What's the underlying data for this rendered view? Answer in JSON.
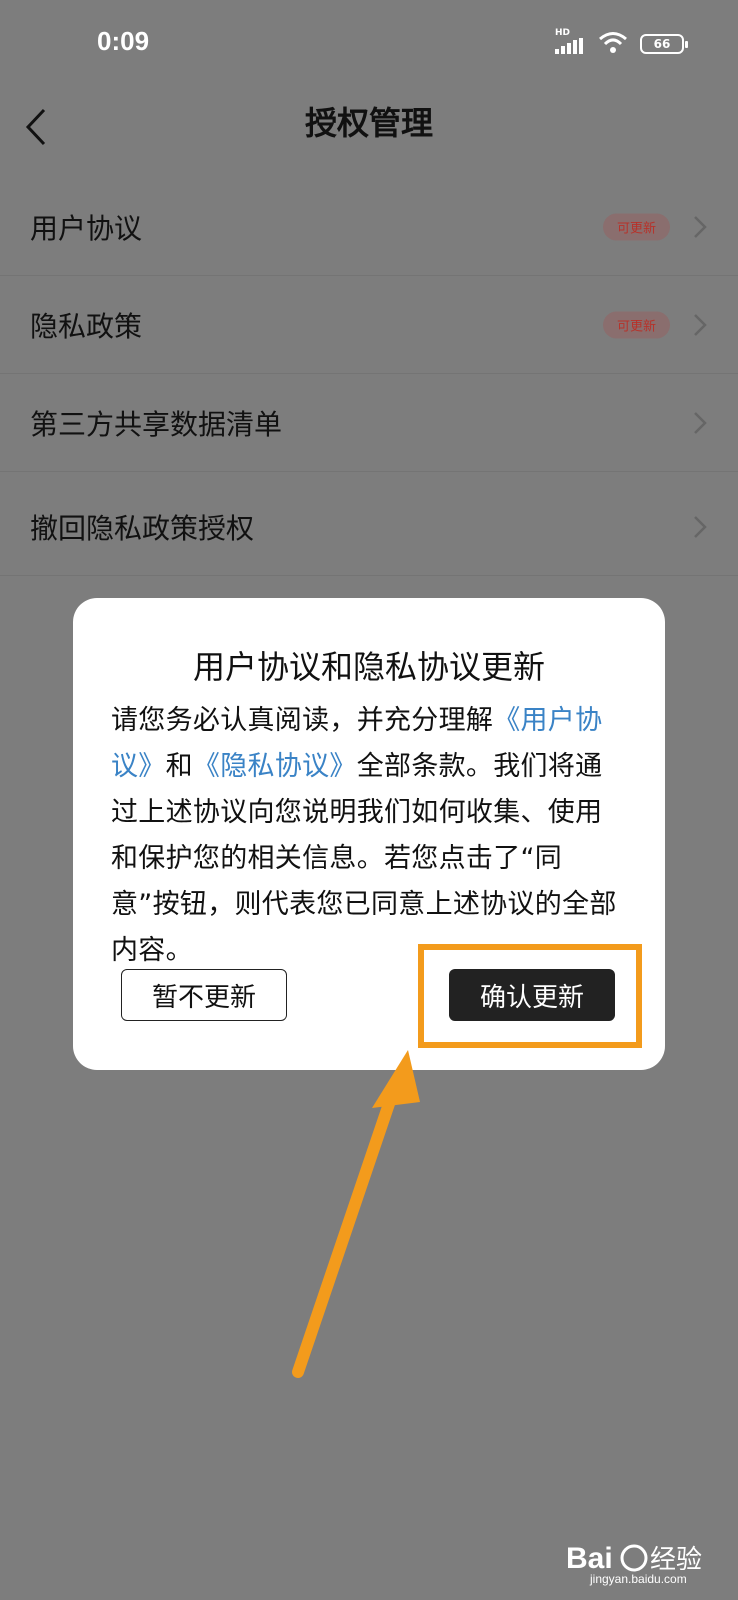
{
  "status_bar": {
    "time": "0:09",
    "network": "HD",
    "battery": "66"
  },
  "header": {
    "title": "授权管理"
  },
  "list": {
    "items": [
      {
        "label": "用户协议",
        "badge": "可更新"
      },
      {
        "label": "隐私政策",
        "badge": "可更新"
      },
      {
        "label": "第三方共享数据清单",
        "badge": ""
      },
      {
        "label": "撤回隐私政策授权",
        "badge": ""
      }
    ]
  },
  "dialog": {
    "title": "用户协议和隐私协议更新",
    "body_part1": "请您务必认真阅读，并充分理解",
    "link_user_agreement": "《用户协议》",
    "body_part2": "和",
    "link_privacy_agreement": "《隐私协议》",
    "body_part3": "全部条款。我们将通过上述协议向您说明我们如何收集、使用和保护您的相关信息。若您点击了“同意”按钮，则代表您已同意上述协议的全部内容。",
    "cancel_label": "暂不更新",
    "confirm_label": "确认更新"
  },
  "annotation": {
    "highlight_color": "#f39b1c"
  },
  "watermark": {
    "logo": "Bai经验",
    "url": "jingyan.baidu.com"
  }
}
